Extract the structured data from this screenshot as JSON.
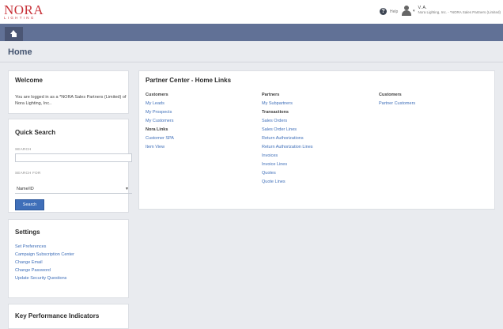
{
  "brand": {
    "name": "NORA",
    "sub": "LIGHTING"
  },
  "header": {
    "help_label": "Help",
    "user_name": "V. A.",
    "user_role": "Nora Lighting, Inc. - *NORA Sales Partners (Limited)"
  },
  "page": {
    "title": "Home"
  },
  "welcome": {
    "title": "Welcome",
    "text": "You are logged in as a *NORA Sales Partners (Limited) of Nora Lighting, Inc.."
  },
  "quick_search": {
    "title": "Quick Search",
    "search_label": "SEARCH",
    "search_value": "",
    "search_for_label": "SEARCH FOR",
    "search_for_value": "Name/ID",
    "button": "Search"
  },
  "settings": {
    "title": "Settings",
    "links": [
      "Set Preferences",
      "Campaign Subscription Center",
      "Change Email",
      "Change Password",
      "Update Security Questions"
    ]
  },
  "kpi": {
    "title": "Key Performance Indicators"
  },
  "home_links": {
    "title": "Partner Center - Home Links",
    "col1": {
      "heading": "Customers",
      "links": [
        "My Leads",
        "My Prospects",
        "My Customers"
      ],
      "heading2": "Nora Links",
      "links2": [
        "Customer SPA",
        "Item View"
      ]
    },
    "col2": {
      "heading": "Partners",
      "links": [
        "My Subpartners"
      ],
      "heading2": "Transactions",
      "links2": [
        "Sales Orders",
        "Sales Order Lines",
        "Return Authorizations",
        "Return Authorization Lines",
        "Invoices",
        "Invoice Lines",
        "Quotes",
        "Quote Lines"
      ]
    },
    "col3": {
      "heading": "Customers",
      "links": [
        "Partner Customers"
      ]
    }
  },
  "colors": {
    "brand": "#c8333a",
    "nav": "#617196",
    "link": "#3f6fb9",
    "button": "#3f6fb9"
  },
  "icons": [
    "home-icon",
    "help-icon",
    "user-icon",
    "chevron-down-icon"
  ]
}
